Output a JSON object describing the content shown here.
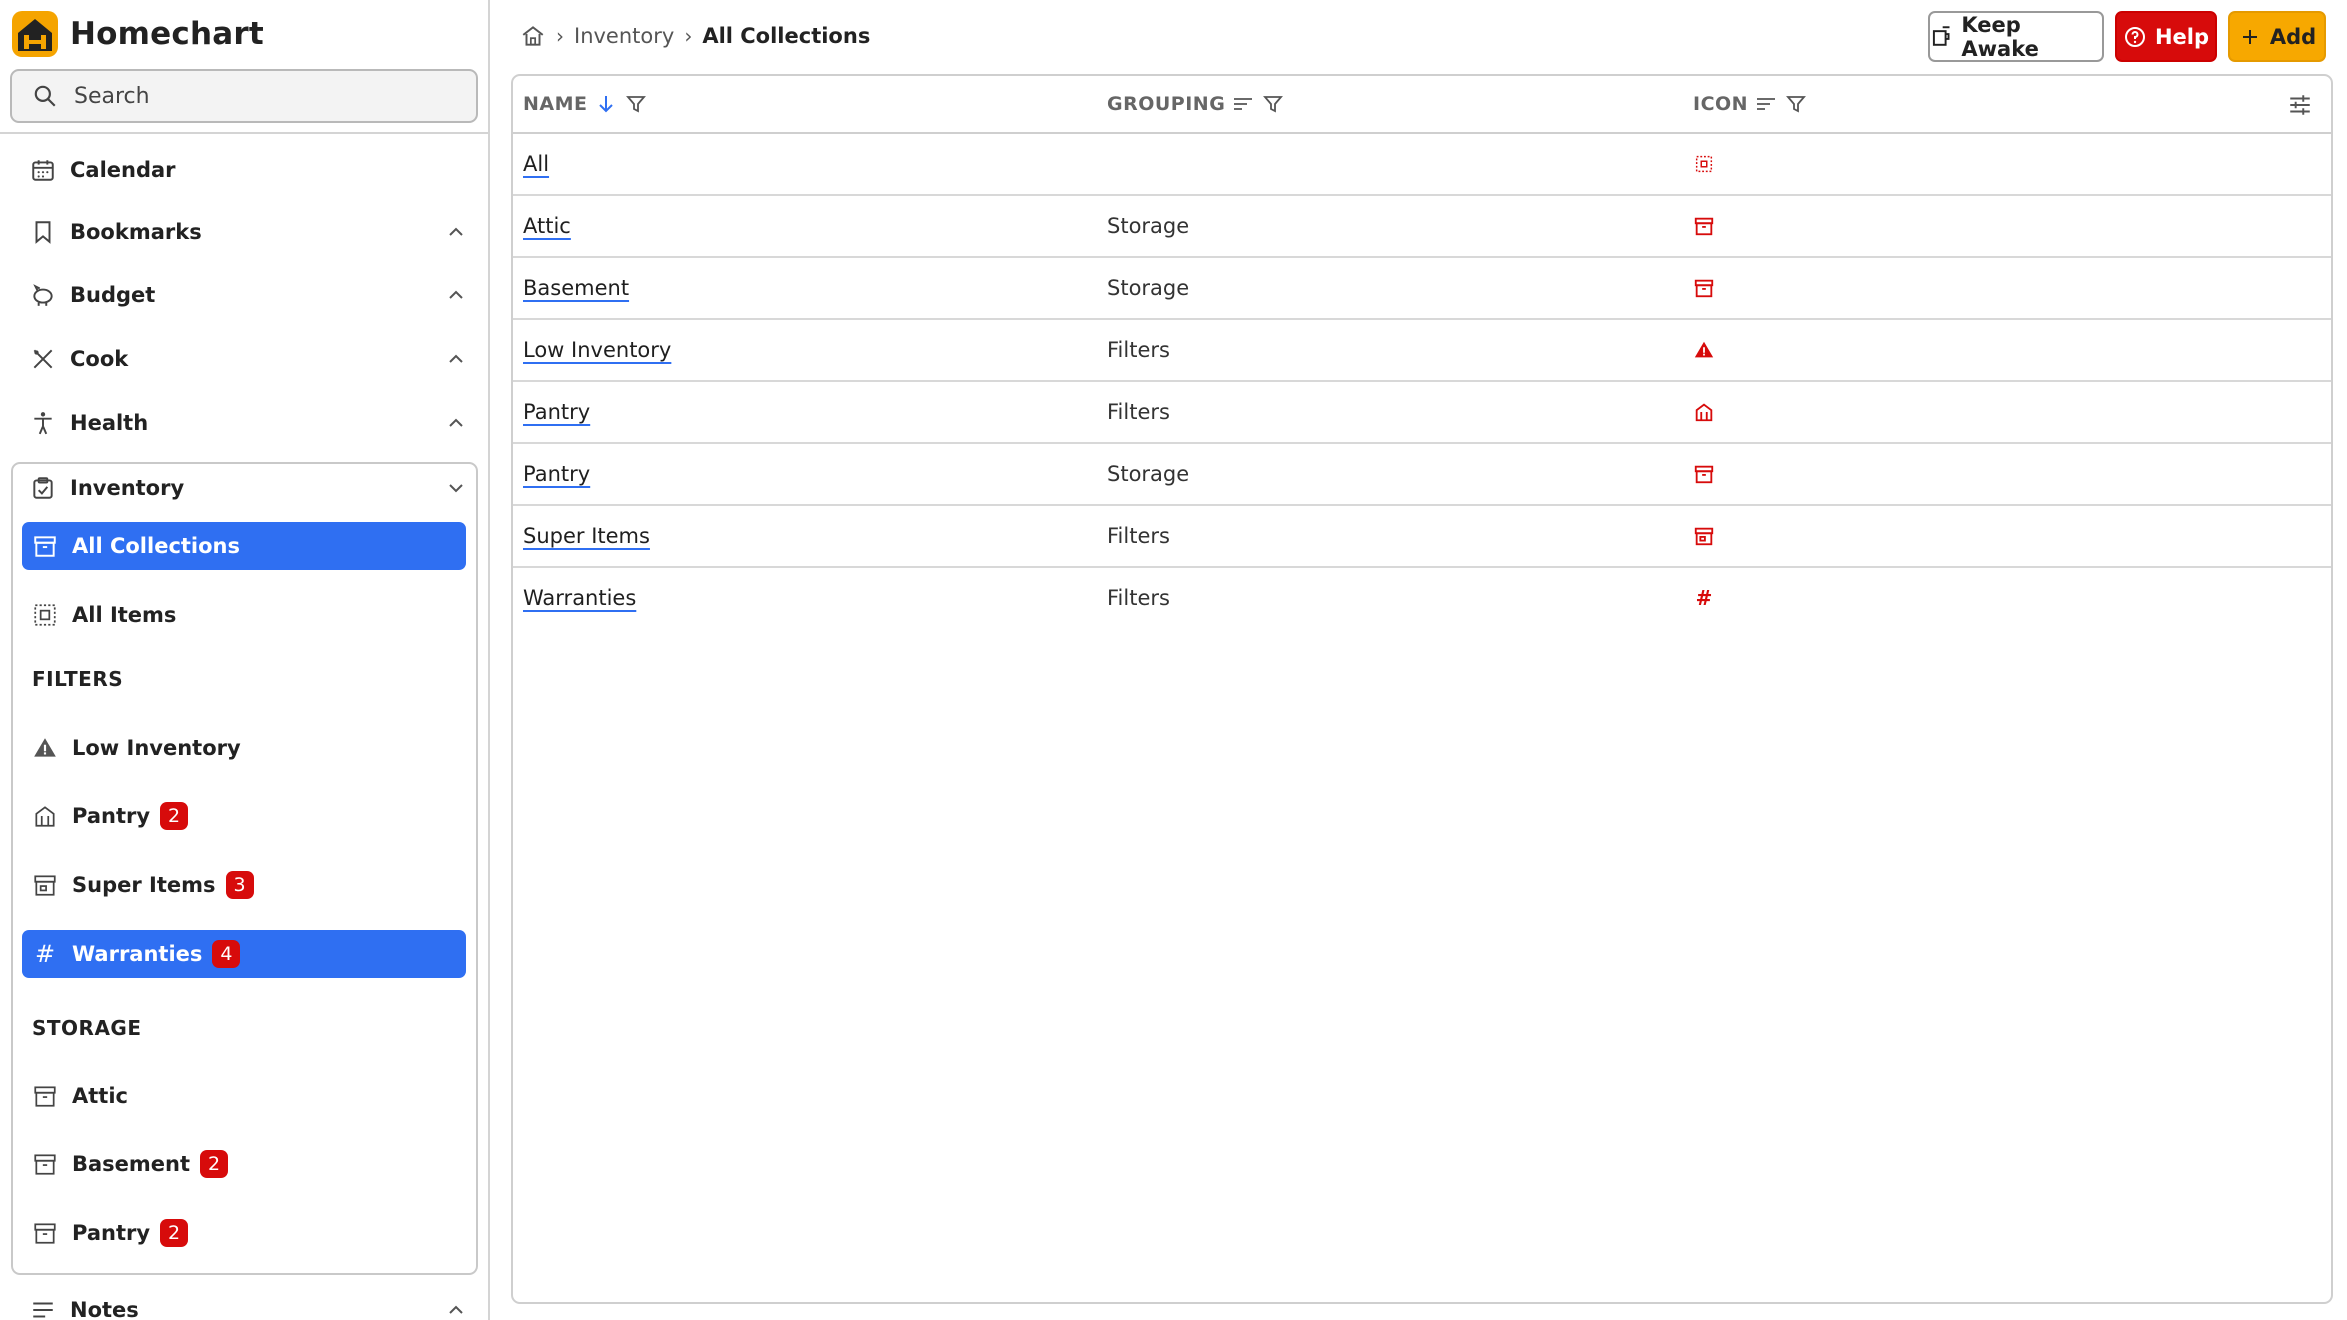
{
  "app": {
    "name": "Homechart"
  },
  "search": {
    "placeholder": "Search"
  },
  "nav": {
    "items": [
      {
        "label": "Calendar",
        "icon": "calendar-icon"
      },
      {
        "label": "Bookmarks",
        "icon": "bookmark-icon"
      },
      {
        "label": "Budget",
        "icon": "piggy-bank-icon"
      },
      {
        "label": "Cook",
        "icon": "utensils-icon"
      },
      {
        "label": "Health",
        "icon": "accessibility-icon"
      },
      {
        "label": "Inventory",
        "icon": "inventory-icon"
      },
      {
        "label": "Notes",
        "icon": "notes-icon"
      }
    ],
    "inventory": {
      "all_collections": "All Collections",
      "all_items": "All Items",
      "filters_heading": "FILTERS",
      "filters": [
        {
          "label": "Low Inventory",
          "badge": ""
        },
        {
          "label": "Pantry",
          "badge": "2"
        },
        {
          "label": "Super Items",
          "badge": "3"
        },
        {
          "label": "Warranties",
          "badge": "4"
        }
      ],
      "storage_heading": "STORAGE",
      "storage": [
        {
          "label": "Attic",
          "badge": ""
        },
        {
          "label": "Basement",
          "badge": "2"
        },
        {
          "label": "Pantry",
          "badge": "2"
        }
      ]
    }
  },
  "breadcrumb": {
    "home_icon": "home-icon",
    "parent": "Inventory",
    "current": "All Collections"
  },
  "toolbar": {
    "keep_awake": "Keep Awake",
    "help": "Help",
    "add": "Add"
  },
  "table": {
    "columns": [
      "NAME",
      "GROUPING",
      "ICON"
    ],
    "rows": [
      {
        "name": "All",
        "grouping": "",
        "icon": "all-items-icon"
      },
      {
        "name": "Attic",
        "grouping": "Storage",
        "icon": "box-icon"
      },
      {
        "name": "Basement",
        "grouping": "Storage",
        "icon": "box-icon"
      },
      {
        "name": "Low Inventory",
        "grouping": "Filters",
        "icon": "warning-icon"
      },
      {
        "name": "Pantry",
        "grouping": "Filters",
        "icon": "pantry-icon"
      },
      {
        "name": "Pantry",
        "grouping": "Storage",
        "icon": "box-icon"
      },
      {
        "name": "Super Items",
        "grouping": "Filters",
        "icon": "store-icon"
      },
      {
        "name": "Warranties",
        "grouping": "Filters",
        "icon": "tag-icon"
      }
    ]
  },
  "colors": {
    "brand": "#f5a400",
    "accent": "#2f6ff2",
    "danger": "#d70b0b"
  }
}
